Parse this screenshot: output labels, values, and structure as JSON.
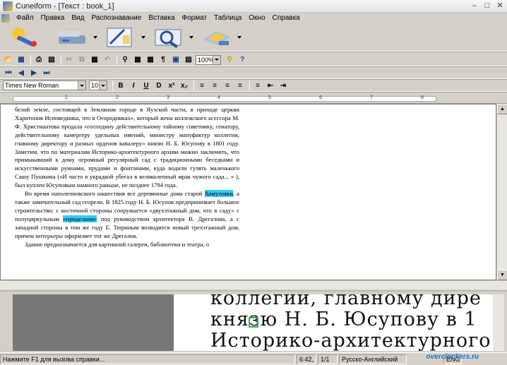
{
  "window": {
    "title": "Cuneiform - [Текст : book_1]"
  },
  "menu": [
    "Файл",
    "Правка",
    "Вид",
    "Распознавание",
    "Вставка",
    "Формат",
    "Таблица",
    "Окно",
    "Справка"
  ],
  "format_bar": {
    "font": "Times New Roman",
    "size": "10"
  },
  "zoom": "100%",
  "ruler_numbers": [
    "1",
    "2",
    "3",
    "4",
    "5",
    "6",
    "7",
    "8"
  ],
  "document": {
    "paragraphs": [
      {
        "parts": [
          {
            "t": "белой земле, состоящей в Земляном городе в Яузской части, в приходе церкви Харитония Исповедника, что в Огородниках», который жена коллежского асессора М. Ф. Христиантова продала «господину действительному тайному советнику, сенатору, действительному камергеру удельных имений, министру мануфактур коллегии, главному директору и разных орденов кавалеру» князю Н. Б. Юсупову в 1801 году. Заметим, что по материалам Историко-архитектурного архива можно заключить, что примыкавший к дому огромный регулярный сад с традиционными беседками и искусственными руинами, прудами и фонтанами, куда водили гулять маленького Сашу Пушкина («И часто я украдкой убегал в великолепный мрак чужого сада... » ), был куплен Юсуповым намного раньше, не позднее 1794 года."
          }
        ],
        "indent": false
      },
      {
        "parts": [
          {
            "t": "Во время наполеоновского нашествия все деревянные дома старой "
          },
          {
            "t": "Хомутовки",
            "hl": true
          },
          {
            "t": ", а также замечательный сад сгорели. В 1825 году Н. Б. Юсупов предпринимает большое строительство: с восточной стороны сооружается «двухэтажный дом, что в саду» с полуциркульным "
          },
          {
            "t": "«приделком»",
            "hl": true
          },
          {
            "t": " под руководством архитектора В. Дрегалова, а с западной стороны в том же году Е. Тюрнным возводится новый трехэтажный дом, причем интерьеры оформляет тот же Дрегалов."
          }
        ],
        "indent": true
      },
      {
        "parts": [
          {
            "t": "Здание предназначается для картинной галереи, библиотеки и театра, о"
          }
        ],
        "indent": true
      }
    ]
  },
  "preview_lines": [
    "коллегии, главному дире",
    "князю Н. Б. Юсупову в 1",
    "Историко-архитектурного"
  ],
  "status": {
    "help": "Нажмите F1 для вызова справки...",
    "position": "6:42,",
    "page": "1/1",
    "language": "Русско-Английский",
    "keyboard": "ENG"
  },
  "watermark": "overclockers.ru"
}
